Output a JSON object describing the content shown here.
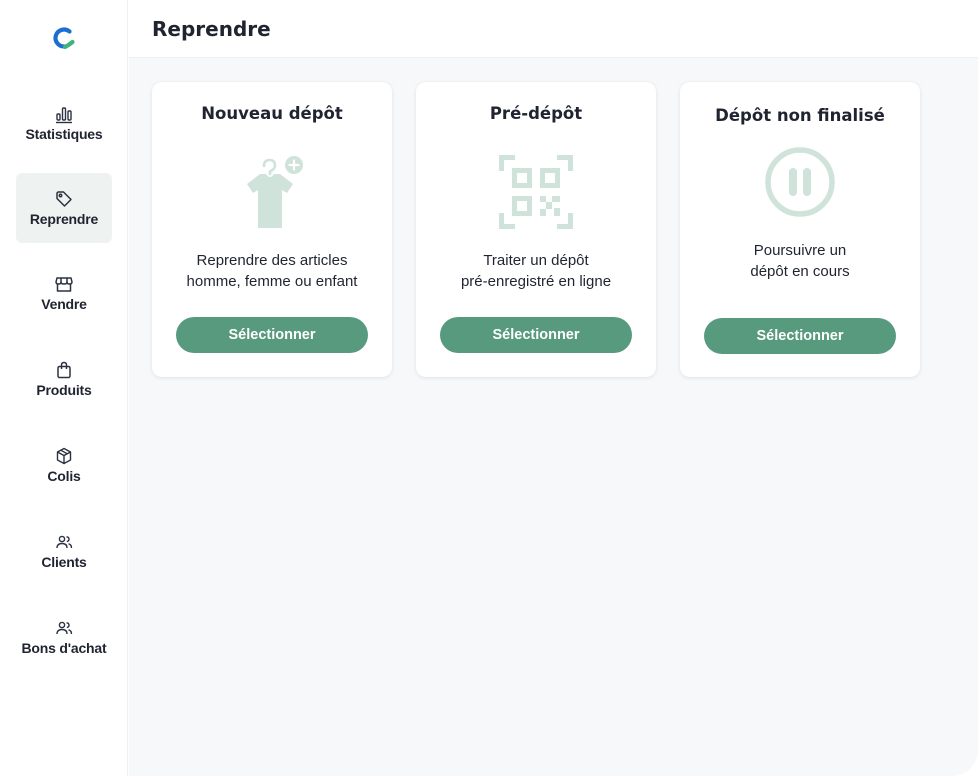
{
  "app": {
    "accent_color": "#579a7d",
    "illustration_color": "#cfe3da",
    "logo_colors": [
      "#1c6fd1",
      "#3fb27f"
    ]
  },
  "sidebar": {
    "items": [
      {
        "label": "Statistiques",
        "icon": "bar-chart-icon",
        "active": false
      },
      {
        "label": "Reprendre",
        "icon": "tag-icon",
        "active": true
      },
      {
        "label": "Vendre",
        "icon": "store-icon",
        "active": false
      },
      {
        "label": "Produits",
        "icon": "shopping-bag-icon",
        "active": false
      },
      {
        "label": "Colis",
        "icon": "package-icon",
        "active": false
      },
      {
        "label": "Clients",
        "icon": "users-icon",
        "active": false
      },
      {
        "label": "Bons d'achat",
        "icon": "users-icon",
        "active": false
      }
    ]
  },
  "header": {
    "title": "Reprendre"
  },
  "cards": [
    {
      "title": "Nouveau dépôt",
      "illustration": "tshirt-hanger-plus-icon",
      "description_lines": [
        "Reprendre des articles",
        "homme, femme ou enfant"
      ],
      "button_label": "Sélectionner"
    },
    {
      "title": "Pré-dépôt",
      "illustration": "qr-code-icon",
      "description_lines": [
        "Traiter un dépôt",
        "pré-enregistré en ligne"
      ],
      "button_label": "Sélectionner"
    },
    {
      "title": "Dépôt non finalisé",
      "illustration": "pause-circle-icon",
      "description_lines": [
        "Poursuivre un",
        "dépôt en cours"
      ],
      "button_label": "Sélectionner"
    }
  ]
}
